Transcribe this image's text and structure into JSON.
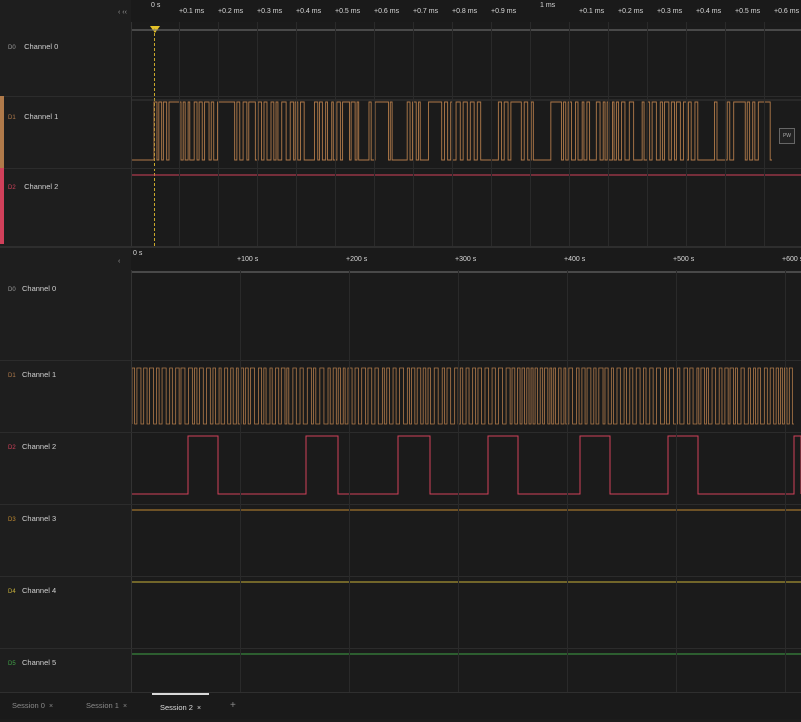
{
  "top_pane": {
    "ruler_control": "‹ ‹‹",
    "ruler_start": "0 s",
    "ruler_ticks": [
      "+0.1 ms",
      "+0.2 ms",
      "+0.3 ms",
      "+0.4 ms",
      "+0.5 ms",
      "+0.6 ms",
      "+0.7 ms",
      "+0.8 ms",
      "+0.9 ms",
      "1 ms",
      "+0.1 ms",
      "+0.2 ms",
      "+0.3 ms",
      "+0.4 ms",
      "+0.5 ms",
      "+0.6 ms"
    ],
    "channels": [
      {
        "num": "D0",
        "name": "Channel 0",
        "color": "#9a9a9a"
      },
      {
        "num": "D1",
        "name": "Channel 1",
        "color": "#b07a4a"
      },
      {
        "num": "D2",
        "name": "Channel 2",
        "color": "#d0405a"
      }
    ],
    "measure_label": "PW"
  },
  "bottom_pane": {
    "ruler_control": "‹",
    "ruler_start": "0 s",
    "ruler_ticks": [
      "+100 s",
      "+200 s",
      "+300 s",
      "+400 s",
      "+500 s",
      "+600 s"
    ],
    "channels": [
      {
        "num": "D0",
        "name": "Channel 0",
        "color": "#9a9a9a"
      },
      {
        "num": "D1",
        "name": "Channel 1",
        "color": "#b07a4a"
      },
      {
        "num": "D2",
        "name": "Channel 2",
        "color": "#d0405a"
      },
      {
        "num": "D3",
        "name": "Channel 3",
        "color": "#c08a30"
      },
      {
        "num": "D4",
        "name": "Channel 4",
        "color": "#c9b23a"
      },
      {
        "num": "D5",
        "name": "Channel 5",
        "color": "#3fa046"
      }
    ]
  },
  "tabs": [
    {
      "label": "Session 0",
      "active": false
    },
    {
      "label": "Session 1",
      "active": false
    },
    {
      "label": "Session 2",
      "active": true
    }
  ],
  "tab_close_glyph": "×",
  "add_tab_glyph": "+"
}
